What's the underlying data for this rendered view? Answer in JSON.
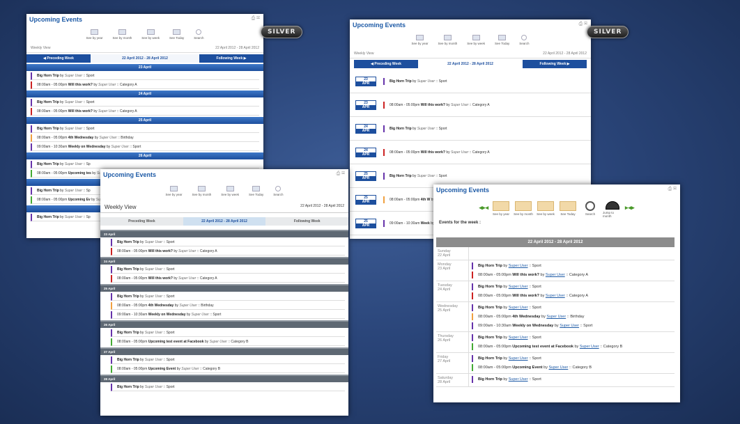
{
  "common": {
    "title": "Upcoming Events",
    "toolbar": [
      "See by year",
      "See by month",
      "See by week",
      "See Today",
      "Search"
    ],
    "by": "by",
    "user": "Super User",
    "sep": "::"
  },
  "badges": [
    "SILVER",
    "SILVER"
  ],
  "p1": {
    "view": "Weekly View",
    "range": "22 April 2012 - 28 April 2012",
    "prev": "Preceding Week",
    "next": "Following Week",
    "days": [
      {
        "label": "23 April",
        "events": [
          {
            "time": "",
            "title": "Big Horn Trip",
            "cat": "Sport",
            "color": "purple"
          },
          {
            "time": "08:00am - 05:00pm",
            "title": "Will this work?",
            "cat": "Category A",
            "color": "red"
          }
        ]
      },
      {
        "label": "24 April",
        "events": [
          {
            "time": "",
            "title": "Big Horn Trip",
            "cat": "Sport",
            "color": "purple"
          },
          {
            "time": "08:00am - 05:00pm",
            "title": "Will this work?",
            "cat": "Category A",
            "color": "red"
          }
        ]
      },
      {
        "label": "25 April",
        "events": [
          {
            "time": "",
            "title": "Big Horn Trip",
            "cat": "Sport",
            "color": "purple"
          },
          {
            "time": "08:00am - 05:00pm",
            "title": "4th Wednesday",
            "cat": "Birthday",
            "color": "orange"
          },
          {
            "time": "09:00am - 10:30am",
            "title": "Weekly on Wednesday",
            "cat": "Sport",
            "color": "purple"
          }
        ]
      },
      {
        "label": "26 April",
        "events": [
          {
            "time": "",
            "title": "Big Horn Trip",
            "cat": "Sp",
            "color": "purple"
          },
          {
            "time": "08:00am - 05:00pm",
            "title": "Upcoming tes",
            "cat": "",
            "color": "green"
          }
        ]
      },
      {
        "label": "",
        "events": [
          {
            "time": "",
            "title": "Big Horn Trip",
            "cat": "Sp",
            "color": "purple"
          },
          {
            "time": "08:00am - 05:00pm",
            "title": "Upcoming Ev",
            "cat": "",
            "color": "green"
          }
        ]
      },
      {
        "label": "",
        "events": [
          {
            "time": "",
            "title": "Big Horn Trip",
            "cat": "Sp",
            "color": "purple"
          }
        ]
      }
    ]
  },
  "p2": {
    "view": "Weekly View",
    "range": "22 April 2012 - 28 April 2012",
    "prev": "Preceding Week",
    "next": "Following Week",
    "rows": [
      {
        "day": "23",
        "month": "APR",
        "time": "",
        "title": "Big Horn Trip",
        "cat": "Sport",
        "color": "purple"
      },
      {
        "day": "23",
        "month": "APR",
        "time": "08:00am - 05:00pm",
        "title": "Will this work?",
        "cat": "Category A",
        "color": "red"
      },
      {
        "day": "24",
        "month": "APR",
        "time": "",
        "title": "Big Horn Trip",
        "cat": "Sport",
        "color": "purple"
      },
      {
        "day": "24",
        "month": "APR",
        "time": "08:00am - 05:00pm",
        "title": "Will this work?",
        "cat": "Category A",
        "color": "red"
      },
      {
        "day": "25",
        "month": "APR",
        "time": "",
        "title": "Big Horn Trip",
        "cat": "Sport",
        "color": "purple"
      },
      {
        "day": "25",
        "month": "APR",
        "time": "08:00am - 05:00pm",
        "title": "4th W",
        "cat": "",
        "color": "orange"
      },
      {
        "day": "25",
        "month": "APR",
        "time": "09:00am - 10:30am",
        "title": "Week",
        "cat": "",
        "color": "purple"
      }
    ]
  },
  "p3": {
    "view": "Weekly View",
    "range": "22 April 2012 - 28 April 2012",
    "prev": "Preceding Week",
    "next": "Following Week",
    "days": [
      {
        "label": "23 April",
        "events": [
          {
            "time": "",
            "title": "Big Horn Trip",
            "cat": "Sport",
            "color": "purple"
          },
          {
            "time": "08:00am - 05:00pm",
            "title": "Will this work?",
            "cat": "Category A",
            "color": "red"
          }
        ]
      },
      {
        "label": "24 April",
        "events": [
          {
            "time": "",
            "title": "Big Horn Trip",
            "cat": "Sport",
            "color": "purple"
          },
          {
            "time": "08:00am - 05:00pm",
            "title": "Will this work?",
            "cat": "Category A",
            "color": "red"
          }
        ]
      },
      {
        "label": "25 April",
        "events": [
          {
            "time": "",
            "title": "Big Horn Trip",
            "cat": "Sport",
            "color": "purple"
          },
          {
            "time": "08:00am - 05:00pm",
            "title": "4th Wednesday",
            "cat": "Birthday",
            "color": "orange"
          },
          {
            "time": "09:00am - 10:30am",
            "title": "Weekly on Wednesday",
            "cat": "Sport",
            "color": "purple"
          }
        ]
      },
      {
        "label": "26 April",
        "events": [
          {
            "time": "",
            "title": "Big Horn Trip",
            "cat": "Sport",
            "color": "purple"
          },
          {
            "time": "08:00am - 05:00pm",
            "title": "Upcoming test event at Facebook",
            "cat": "Category B",
            "color": "green"
          }
        ]
      },
      {
        "label": "27 April",
        "events": [
          {
            "time": "",
            "title": "Big Horn Trip",
            "cat": "Sport",
            "color": "purple"
          },
          {
            "time": "08:00am - 05:00pm",
            "title": "Upcoming Event",
            "cat": "Category B",
            "color": "green"
          }
        ]
      },
      {
        "label": "28 April",
        "events": [
          {
            "time": "",
            "title": "Big Horn Trip",
            "cat": "Sport",
            "color": "purple"
          }
        ]
      }
    ]
  },
  "p4": {
    "toolbar": [
      "See by year",
      "See by month",
      "See by week",
      "See Today",
      "Search",
      "Jump to month"
    ],
    "events_label": "Events for the week :",
    "range": "22 April 2012 - 28 April 2012",
    "days": [
      {
        "name": "Sunday",
        "date": "22 April",
        "events": []
      },
      {
        "name": "Monday",
        "date": "23 April",
        "events": [
          {
            "time": "",
            "title": "Big Horn Trip",
            "cat": "Sport",
            "color": "purple"
          },
          {
            "time": "08:00am - 05:00pm",
            "title": "Will this work?",
            "cat": "Category A",
            "color": "red"
          }
        ]
      },
      {
        "name": "Tuesday",
        "date": "24 April",
        "events": [
          {
            "time": "",
            "title": "Big Horn Trip",
            "cat": "Sport",
            "color": "purple"
          },
          {
            "time": "08:00am - 05:00pm",
            "title": "Will this work?",
            "cat": "Category A",
            "color": "red"
          }
        ]
      },
      {
        "name": "Wednesday",
        "date": "25 April",
        "events": [
          {
            "time": "",
            "title": "Big Horn Trip",
            "cat": "Sport",
            "color": "purple"
          },
          {
            "time": "08:00am - 05:00pm",
            "title": "4th Wednesday",
            "cat": "Birthday",
            "color": "orange"
          },
          {
            "time": "09:00am - 10:30am",
            "title": "Weekly on Wednesday",
            "cat": "Sport",
            "color": "purple"
          }
        ]
      },
      {
        "name": "Thursday",
        "date": "26 April",
        "events": [
          {
            "time": "",
            "title": "Big Horn Trip",
            "cat": "Sport",
            "color": "purple"
          },
          {
            "time": "08:00am - 05:00pm",
            "title": "Upcoming test event at Facebook",
            "cat": "Category B",
            "color": "green"
          }
        ]
      },
      {
        "name": "Friday",
        "date": "27 April",
        "events": [
          {
            "time": "",
            "title": "Big Horn Trip",
            "cat": "Sport",
            "color": "purple"
          },
          {
            "time": "08:00am - 05:00pm",
            "title": "Upcoming Event",
            "cat": "Category B",
            "color": "green"
          }
        ]
      },
      {
        "name": "Saturday",
        "date": "28 April",
        "events": [
          {
            "time": "",
            "title": "Big Horn Trip",
            "cat": "Sport",
            "color": "purple"
          }
        ]
      }
    ]
  }
}
